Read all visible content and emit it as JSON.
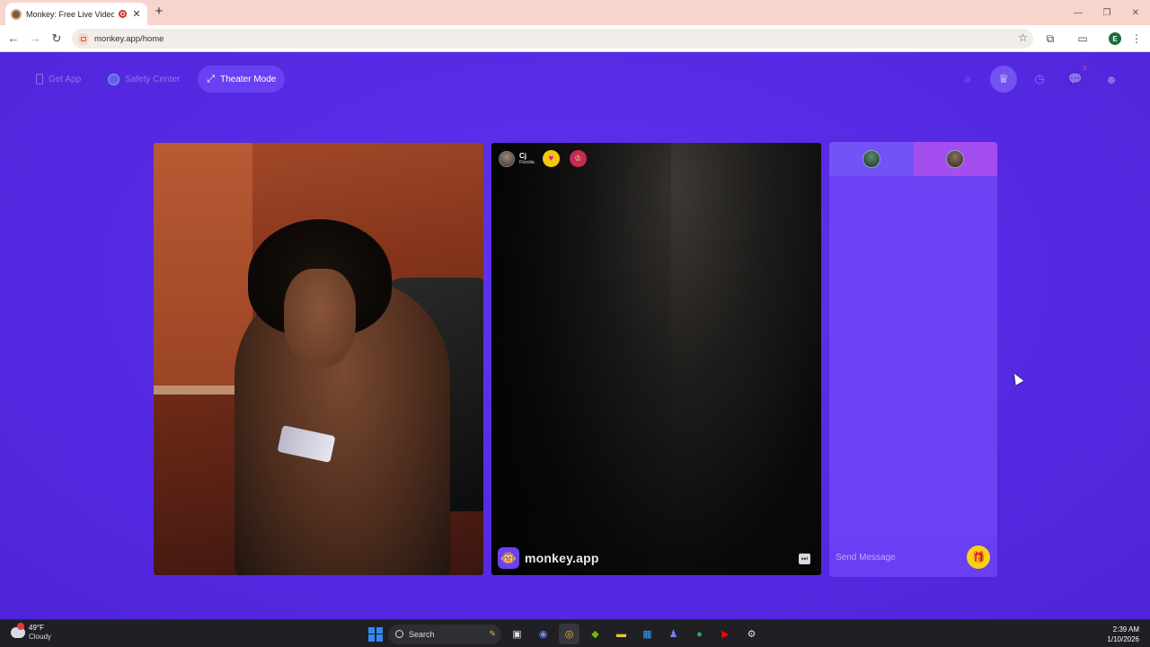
{
  "browser": {
    "tab_title": "Monkey: Free Live Video Cl",
    "tab_close": "✕",
    "new_tab": "+",
    "url": "monkey.app/home",
    "window_controls": [
      "—",
      "❐",
      "✕"
    ]
  },
  "header": {
    "buttons": [
      {
        "label": "Get App",
        "icon": "phone-icon"
      },
      {
        "label": "Safety Center",
        "icon": "shield-icon"
      },
      {
        "label": "Theater Mode",
        "icon": "expand-icon",
        "active": true
      }
    ],
    "notification_count": "3"
  },
  "partner": {
    "name": "Cj",
    "location": "Florida"
  },
  "brand": {
    "text": "monkey.app"
  },
  "chat": {
    "placeholder": "Send Message"
  },
  "taskbar": {
    "temperature": "49°F",
    "condition": "Cloudy",
    "search_label": "Search",
    "time": "2:39 AM",
    "date": "1/10/2026"
  },
  "colors": {
    "page_background": "#5b2ee6",
    "active_button": "#6a41f2",
    "chat_panel": "#6a3ef2",
    "gift_button": "#f6d30f"
  }
}
